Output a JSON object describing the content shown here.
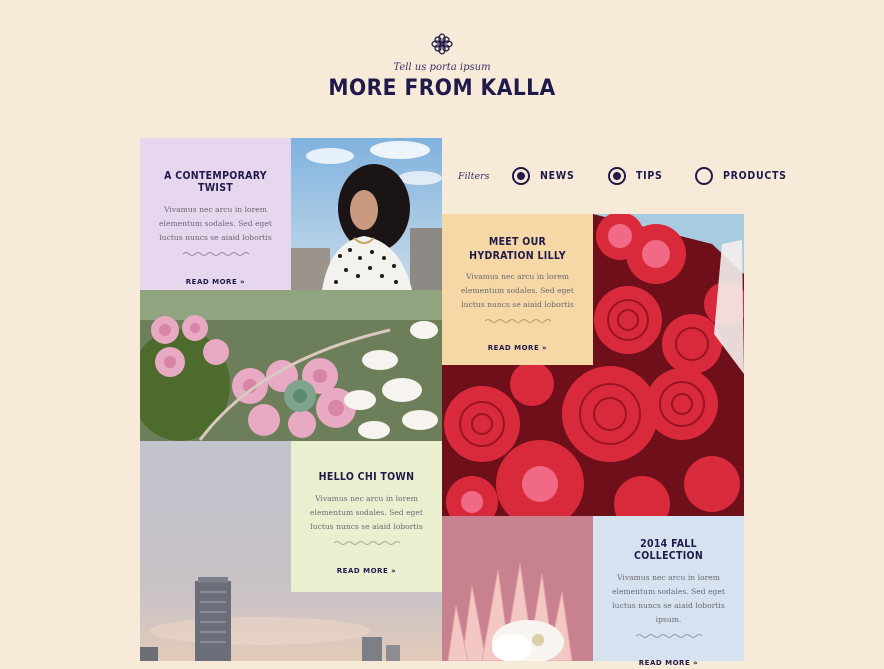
{
  "header": {
    "subtitle": "Tell us porta ipsum",
    "title": "MORE FROM KALLA"
  },
  "filters": {
    "label": "Filters",
    "options": [
      {
        "label": "NEWS",
        "checked": true
      },
      {
        "label": "TIPS",
        "checked": true
      },
      {
        "label": "PRODUCTS",
        "checked": false
      }
    ]
  },
  "cards": [
    {
      "title": "A CONTEMPORARY TWIST",
      "lines": [
        "Vivamus nec arcu in lorem",
        "elementum sodales. Sed eget",
        "luctus nuncs se aiaid lobortis"
      ],
      "cta": "READ MORE »"
    },
    {
      "title_lines": [
        "MEET OUR",
        "HYDRATION LILLY"
      ],
      "lines": [
        "Vivamus nec arcu in lorem",
        "elementum sodales. Sed eget",
        "luctus nuncs se aiaid lobortis"
      ],
      "cta": "READ MORE »"
    },
    {
      "title": "HELLO CHI TOWN",
      "lines": [
        "Vivamus nec arcu in lorem",
        "elementum sodales. Sed eget",
        "luctus nuncs se aiaid lobortis"
      ],
      "cta": "READ MORE »"
    },
    {
      "title": "2014 FALL COLLECTION",
      "lines": [
        "Vivamus nec arcu in lorem",
        "elementum sodales. Sed eget",
        "luctus nuncs se aiaid lobortis",
        "ipsum."
      ],
      "cta": "READ MORE »"
    }
  ],
  "colors": {
    "background": "#f7ead9",
    "navy": "#1f1a4a",
    "lavender": "#e6d6ee",
    "peach": "#f6d7a6",
    "sage": "#e9efcf",
    "sky": "#d7e2f1"
  },
  "icons": {
    "logo": "flower-icon"
  }
}
